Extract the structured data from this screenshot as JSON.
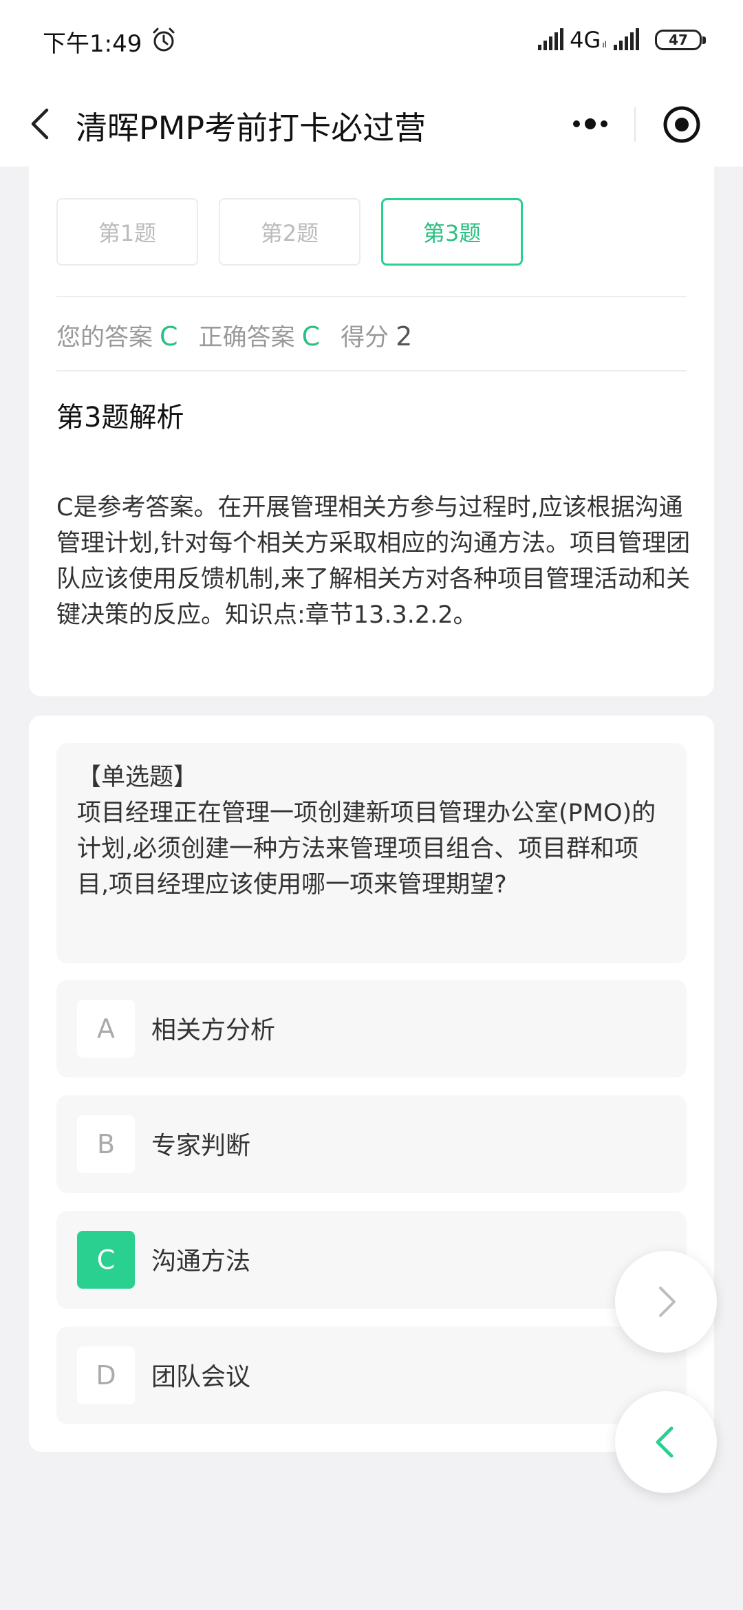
{
  "status_bar": {
    "time": "下午1:49",
    "network": "4G",
    "network_sub": "ıl",
    "battery": "47",
    "icons": [
      "alarm-icon",
      "signal-icon",
      "battery-icon"
    ]
  },
  "nav": {
    "title": "清晖PMP考前打卡必过营",
    "icons": [
      "back-icon",
      "more-icon",
      "target-icon"
    ]
  },
  "question_tabs": [
    {
      "label": "第1题",
      "active": false
    },
    {
      "label": "第2题",
      "active": false
    },
    {
      "label": "第3题",
      "active": true
    }
  ],
  "answer_summary": {
    "your_answer_label": "您的答案",
    "your_answer": "C",
    "correct_answer_label": "正确答案",
    "correct_answer": "C",
    "score_label": "得分",
    "score": "2"
  },
  "analysis": {
    "title": "第3题解析",
    "body": "C是参考答案。在开展管理相关方参与过程时,应该根据沟通管理计划,针对每个相关方采取相应的沟通方法。项目管理团队应该使用反馈机制,来了解相关方对各种项目管理活动和关键决策的反应。知识点:章节13.3.2.2。"
  },
  "question": {
    "type": "【单选题】",
    "text": "项目经理正在管理一项创建新项目管理办公室(PMO)的计划,必须创建一种方法来管理项目组合、项目群和项目,项目经理应该使用哪一项来管理期望?"
  },
  "options": [
    {
      "letter": "A",
      "text": "相关方分析",
      "selected": false
    },
    {
      "letter": "B",
      "text": "专家判断",
      "selected": false
    },
    {
      "letter": "C",
      "text": "沟通方法",
      "selected": true
    },
    {
      "letter": "D",
      "text": "团队会议",
      "selected": false
    }
  ],
  "floating_buttons": [
    "next-icon",
    "previous-icon"
  ],
  "colors": {
    "accent": "#2ad08f",
    "accent_text": "#2ac081",
    "background": "#f2f2f4",
    "card": "#ffffff",
    "option_bg": "#f7f7f8"
  }
}
